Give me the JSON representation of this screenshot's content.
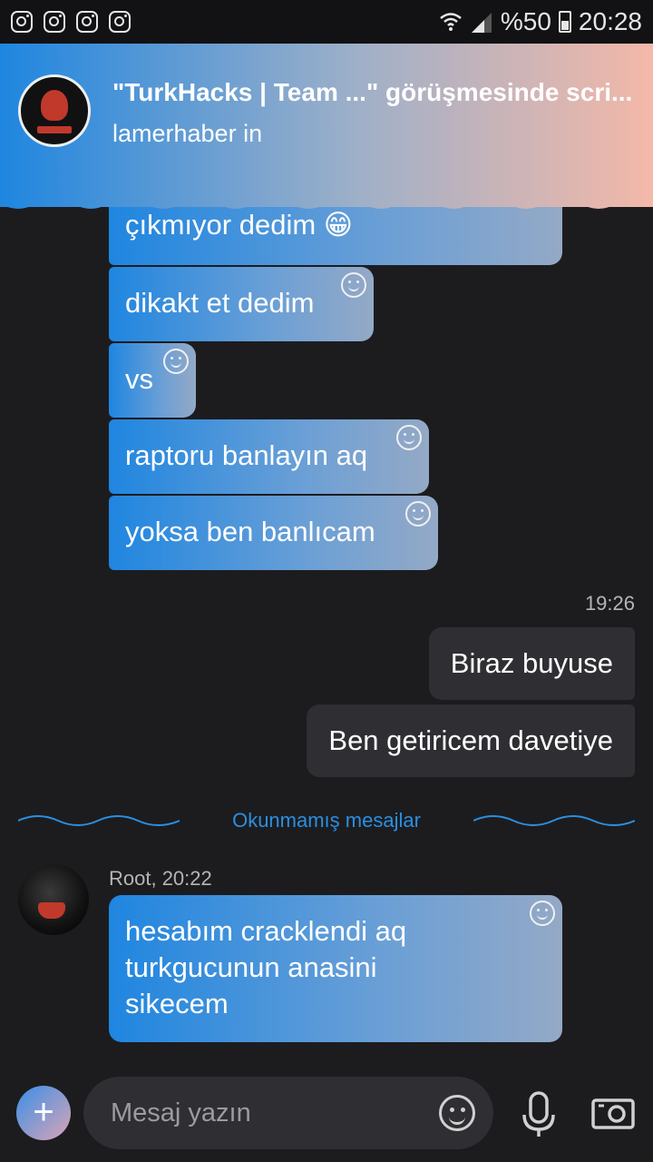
{
  "status_bar": {
    "battery": "%50",
    "time": "20:28"
  },
  "notification": {
    "title": "\"TurkHacks | Team ...\" görüşmesinde scri...",
    "subtitle": "lamerhaber in"
  },
  "messages_top": [
    {
      "text": "çıkmıyor dedim 😁"
    },
    {
      "text": "dikakt et dedim"
    },
    {
      "text": "vs"
    },
    {
      "text": "raptoru banlayın aq"
    },
    {
      "text": "yoksa ben banlıcam"
    }
  ],
  "own_time": "19:26",
  "own_messages": [
    {
      "text": "Biraz buyuse"
    },
    {
      "text": "Ben getiricem davetiye"
    }
  ],
  "unread_label": "Okunmamış mesajlar",
  "root_message": {
    "sender": "Root, 20:22",
    "lines": [
      "hesabım cracklendi aq",
      "turkgucunun anasini",
      "sikecem"
    ]
  },
  "composer": {
    "placeholder": "Mesaj yazın"
  }
}
